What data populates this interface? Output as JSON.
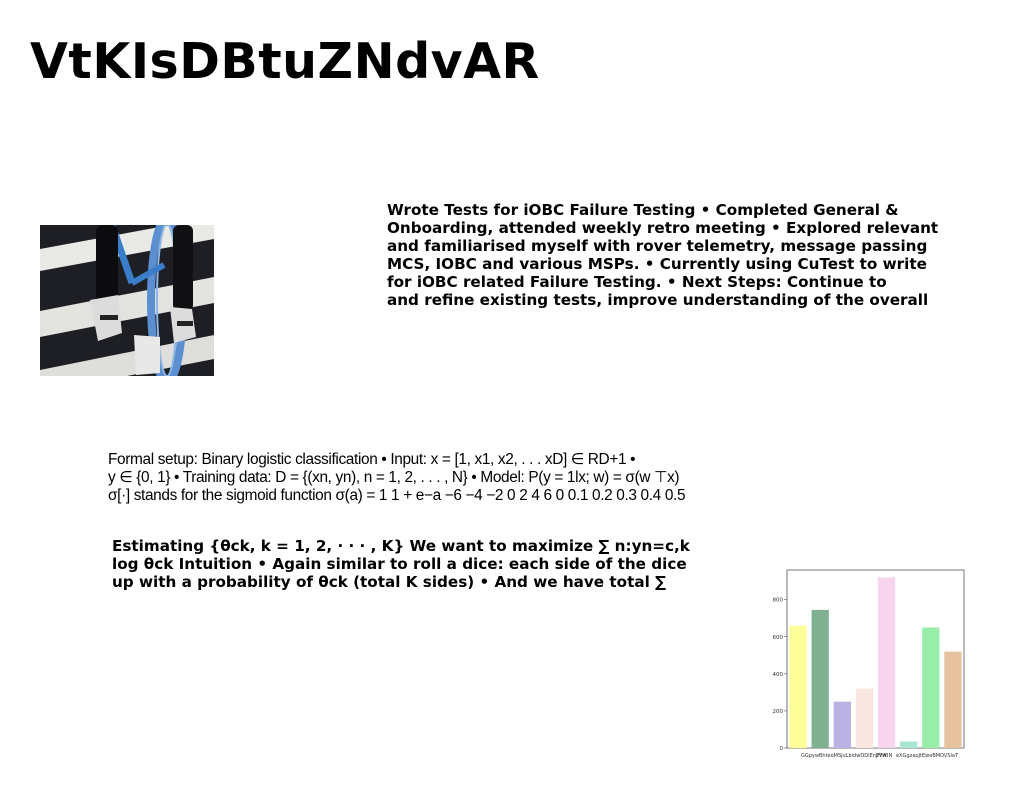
{
  "title": "VtKIsDBtuZNdvAR",
  "paragraph_a": {
    "lines": [
      "Wrote Tests for iOBC Failure Testing • Completed General &",
      "Onboarding, attended weekly retro meeting • Explored relevant",
      "and familiarised myself with rover telemetry, message passing",
      "MCS, IOBC and various MSPs. • Currently using CuTest to write",
      "for iOBC related Failure Testing. • Next Steps: Continue to",
      "and refine existing tests, improve understanding of the overall"
    ]
  },
  "paragraph_b": {
    "lines": [
      "Formal setup: Binary logistic classification • Input: x = [1, x1, x2, . . . xD] ∈ RD+1 •",
      "y ∈ {0, 1} • Training data: D = {(xn, yn), n = 1, 2, . . . , N} • Model: P(y = 1lx; w) = σ(w ⊤x)",
      "σ[·] stands for the sigmoid function σ(a) = 1 1 + e−a −6 −4 −2 0 2 4 6 0 0.1 0.2 0.3 0.4 0.5"
    ]
  },
  "paragraph_c": {
    "lines": [
      "Estimating {θck, k = 1, 2, · · · , K} We want to maximize ∑ n:yn=c,k",
      "log θck Intuition • Again similar to roll a dice: each side of the dice",
      "up with a probability of θck (total K sides) • And we have total ∑"
    ]
  },
  "photo": {
    "subject": "person-riding-bicycle-photo"
  },
  "chart_data": {
    "type": "bar",
    "categories": [
      "GGpyw",
      "BhteoM",
      "SjuLb",
      "idwOD",
      "IEnjFFA",
      "SVzBN",
      "eXGgx",
      "aoJtE",
      "weBMO",
      "VSlaT"
    ],
    "tick_labels": [
      "GGpywBhteoMSjuLbidwODIEnjFFA",
      "SVzBN",
      "eXGgxaoJtEweBMOVSlaT"
    ],
    "values": [
      660,
      745,
      250,
      320,
      920,
      35,
      650,
      520
    ],
    "colors": [
      "#ffff99",
      "#7fb08f",
      "#b9b2e3",
      "#fae6e0",
      "#f7d5ef",
      "#a9e6d1",
      "#98eda8",
      "#e6c2a0"
    ],
    "yticks": [
      0,
      200,
      400,
      600,
      800
    ],
    "ylim": [
      0,
      960
    ],
    "grid": false,
    "legend": "none"
  }
}
